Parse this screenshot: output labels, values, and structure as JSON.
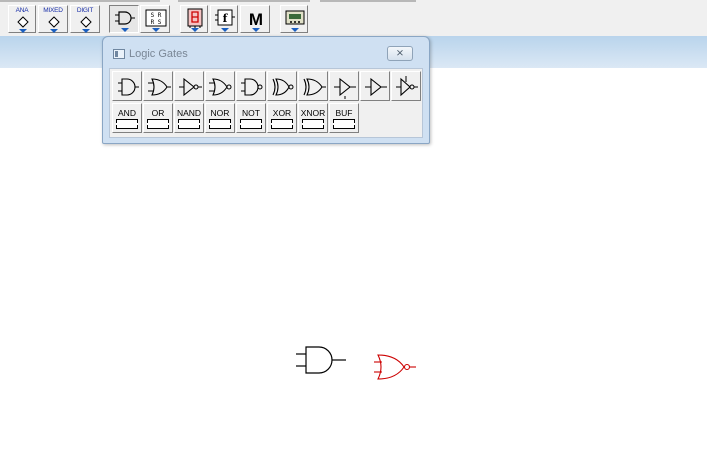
{
  "toolbar": {
    "buttons": [
      {
        "name": "ana-button",
        "label": "ANA"
      },
      {
        "name": "mixed-button",
        "label": "MIXED"
      },
      {
        "name": "digit-button",
        "label": "DIGIT"
      }
    ]
  },
  "palette": {
    "title": "Logic Gates",
    "close_symbol": "⨯",
    "labeled_gates": [
      "AND",
      "OR",
      "NAND",
      "NOR",
      "NOT",
      "XOR",
      "XNOR",
      "BUF"
    ]
  },
  "colors": {
    "arrow": "#1a5fc0",
    "selected_gate": "#cc0000"
  }
}
